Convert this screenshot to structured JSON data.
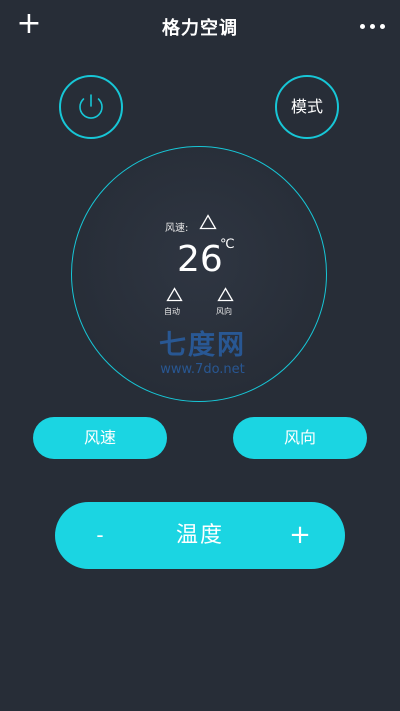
{
  "header": {
    "add_symbol": "+",
    "title": "格力空调",
    "more_icon": "more-dots-icon"
  },
  "controls": {
    "power_icon": "power-icon",
    "mode_label": "模式"
  },
  "dial": {
    "fan_speed_label": "风速:",
    "temperature": "26",
    "unit": "℃",
    "auto_label": "自动",
    "direction_label": "风向",
    "accent_color": "#17c6d6"
  },
  "watermark": {
    "brand": "七度网",
    "url": "www.7do.net"
  },
  "buttons": {
    "wind_speed": "风速",
    "wind_direction": "风向"
  },
  "temp_bar": {
    "minus": "-",
    "label": "温度",
    "plus": "+",
    "color": "#1bd5e2"
  }
}
